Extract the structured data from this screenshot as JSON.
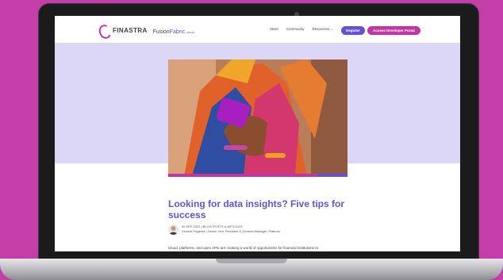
{
  "colors": {
    "background": "#c43ea9",
    "brand_purple": "#694ed6",
    "brand_magenta": "#c137a2",
    "hero_band": "#dcd6f7"
  },
  "header": {
    "logo_finastra": "FINASTRA",
    "logo_fusion": "Fusion",
    "logo_fabric": "Fabric",
    "logo_cloud": ".cloud",
    "nav": [
      "Store",
      "Community",
      "Resources"
    ],
    "register_label": "Register",
    "portal_label": "Access Developer Portal"
  },
  "article": {
    "title": "Looking for data insights? Five tips for success",
    "meta": "30 SEP 2021 | BLOG POSTS & ARTICLES",
    "author": "Vincent Pugliese | Senior Vice President & General Manager, Platform",
    "body_excerpt": "Cloud, platforms, and open APIs are creating a world of opportunities for financial institutions to"
  }
}
